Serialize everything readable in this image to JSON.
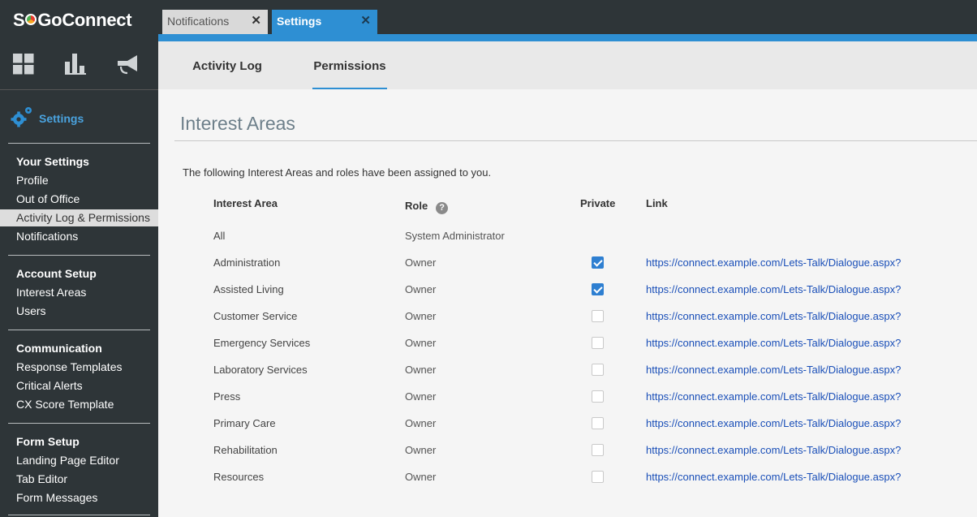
{
  "logo": {
    "prefix": "S",
    "suffix": "GoConnect"
  },
  "top_icons": [
    "dashboard-grid-icon",
    "bar-chart-icon",
    "megaphone-icon"
  ],
  "tabs": [
    {
      "label": "Notifications",
      "active": false
    },
    {
      "label": "Settings",
      "active": true
    }
  ],
  "close_glyph": "✕",
  "sidebar": {
    "settings_label": "Settings",
    "groups": [
      {
        "title": "Your Settings",
        "items": [
          "Profile",
          "Out of Office",
          "Activity Log & Permissions",
          "Notifications"
        ]
      },
      {
        "title": "Account Setup",
        "items": [
          "Interest Areas",
          "Users"
        ]
      },
      {
        "title": "Communication",
        "items": [
          "Response Templates",
          "Critical Alerts",
          "CX Score Template"
        ]
      },
      {
        "title": "Form Setup",
        "items": [
          "Landing Page Editor",
          "Tab Editor",
          "Form Messages"
        ]
      }
    ],
    "active_item": "Activity Log & Permissions"
  },
  "subnav": {
    "activity": "Activity Log",
    "permissions": "Permissions",
    "active": "Permissions"
  },
  "main": {
    "title": "Interest Areas",
    "intro": "The following Interest Areas and roles have been assigned to you.",
    "columns": {
      "area": "Interest Area",
      "role": "Role",
      "private": "Private",
      "link": "Link"
    },
    "help_glyph": "?",
    "rows": [
      {
        "area": "All",
        "role": "System Administrator",
        "private": null,
        "link": ""
      },
      {
        "area": "Administration",
        "role": "Owner",
        "private": true,
        "link": "https://connect.example.com/Lets-Talk/Dialogue.aspx?"
      },
      {
        "area": "Assisted Living",
        "role": "Owner",
        "private": true,
        "link": "https://connect.example.com/Lets-Talk/Dialogue.aspx?"
      },
      {
        "area": "Customer Service",
        "role": "Owner",
        "private": false,
        "link": "https://connect.example.com/Lets-Talk/Dialogue.aspx?"
      },
      {
        "area": "Emergency Services",
        "role": "Owner",
        "private": false,
        "link": "https://connect.example.com/Lets-Talk/Dialogue.aspx?"
      },
      {
        "area": "Laboratory Services",
        "role": "Owner",
        "private": false,
        "link": "https://connect.example.com/Lets-Talk/Dialogue.aspx?"
      },
      {
        "area": "Press",
        "role": "Owner",
        "private": false,
        "link": "https://connect.example.com/Lets-Talk/Dialogue.aspx?"
      },
      {
        "area": "Primary Care",
        "role": "Owner",
        "private": false,
        "link": "https://connect.example.com/Lets-Talk/Dialogue.aspx?"
      },
      {
        "area": "Rehabilitation",
        "role": "Owner",
        "private": false,
        "link": "https://connect.example.com/Lets-Talk/Dialogue.aspx?"
      },
      {
        "area": "Resources",
        "role": "Owner",
        "private": false,
        "link": "https://connect.example.com/Lets-Talk/Dialogue.aspx?"
      }
    ]
  },
  "colors": {
    "accent": "#2e8fd3",
    "sidebar_bg": "#2e3538",
    "link": "#1a4fb8",
    "checkbox_checked": "#2e7fd1"
  }
}
